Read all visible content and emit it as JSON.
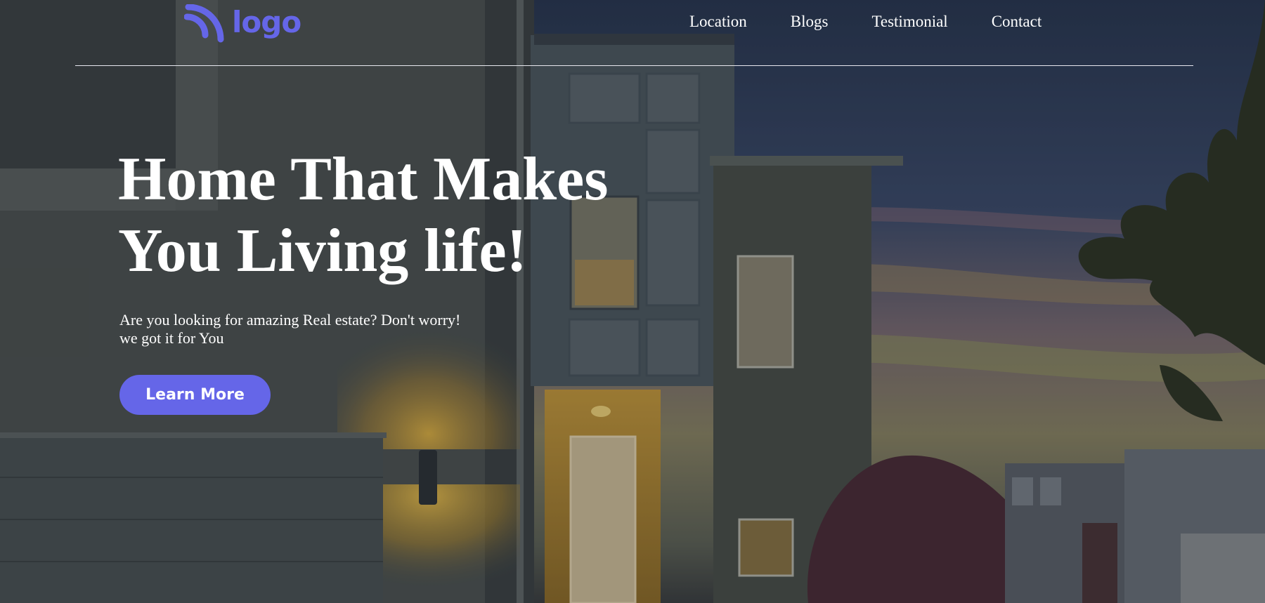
{
  "brand": {
    "logo_text": "logo",
    "logo_icon": "rss-arcs-icon",
    "accent": "#6566e8"
  },
  "nav": {
    "items": [
      {
        "label": "Location"
      },
      {
        "label": "Blogs"
      },
      {
        "label": "Testimonial"
      },
      {
        "label": "Contact"
      }
    ]
  },
  "hero": {
    "headline_line1": "Home That Makes",
    "headline_line2": "You Living life!",
    "subtext_line1": "Are you looking for amazing Real estate? Don't worry!",
    "subtext_line2": "we got it for You",
    "cta_label": "Learn More",
    "background": "house-at-dusk-photo"
  }
}
